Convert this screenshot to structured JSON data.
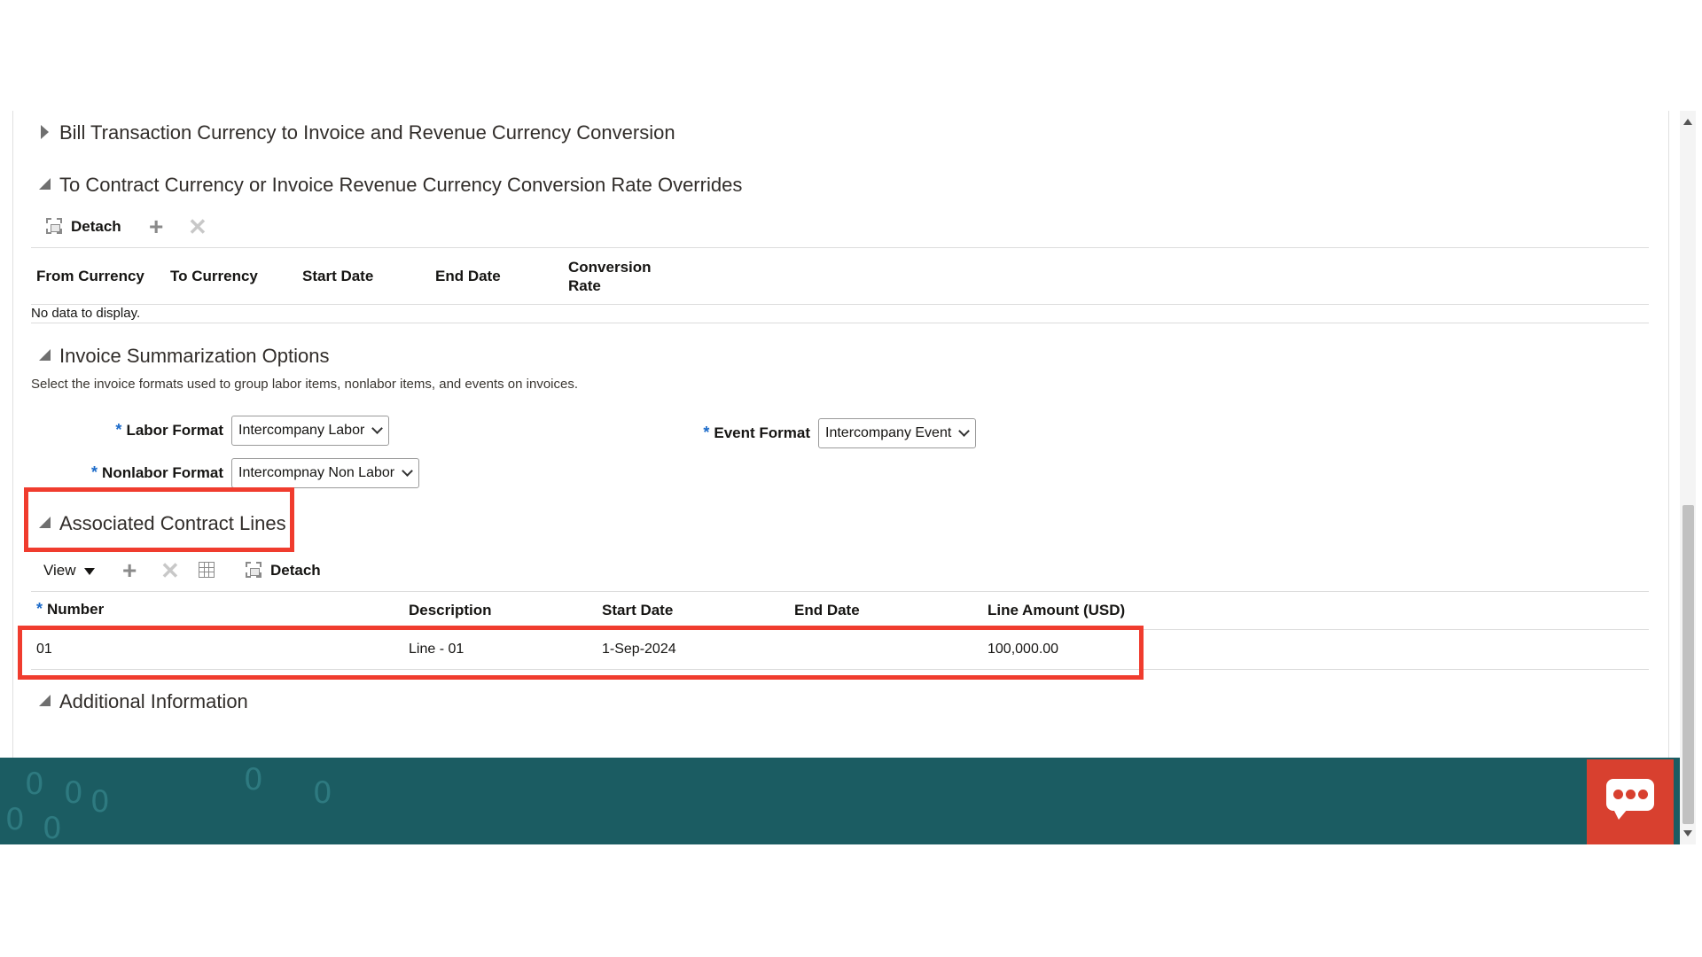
{
  "sections": {
    "bill_conversion": {
      "title": "Bill Transaction Currency to Invoice and Revenue Currency Conversion"
    },
    "rate_overrides": {
      "title": "To Contract Currency or Invoice Revenue Currency Conversion Rate Overrides",
      "toolbar": {
        "detach_label": "Detach"
      },
      "columns": [
        "From Currency",
        "To Currency",
        "Start Date",
        "End Date",
        "Conversion",
        "Rate"
      ],
      "empty_message": "No data to display."
    },
    "invoice_summarization": {
      "title": "Invoice Summarization Options",
      "description": "Select the invoice formats used to group labor items, nonlabor items, and events on invoices.",
      "labor_format": {
        "label": "Labor Format",
        "value": "Intercompany Labor"
      },
      "nonlabor_format": {
        "label": "Nonlabor Format",
        "value": "Intercompnay Non Labor"
      },
      "event_format": {
        "label": "Event Format",
        "value": "Intercompany Event"
      },
      "required_mark": "*"
    },
    "associated_lines": {
      "title": "Associated Contract Lines",
      "toolbar": {
        "view_label": "View",
        "detach_label": "Detach"
      },
      "columns": {
        "number": "Number",
        "description": "Description",
        "start_date": "Start Date",
        "end_date": "End Date",
        "line_amount": "Line Amount (USD)"
      },
      "rows": [
        {
          "number": "01",
          "description": "Line - 01",
          "start_date": "1-Sep-2024",
          "end_date": "",
          "line_amount": "100,000.00"
        }
      ]
    },
    "additional_info": {
      "title": "Additional Information"
    }
  },
  "colors": {
    "highlight": "#f03c2e",
    "footer": "#1b5c62",
    "chat_button": "#d8402f",
    "required": "#1b6ac9"
  },
  "icons": [
    "expand-triangle-icon",
    "collapse-triangle-icon",
    "detach-icon",
    "add-icon",
    "delete-icon",
    "freeze-icon",
    "chat-icon"
  ]
}
